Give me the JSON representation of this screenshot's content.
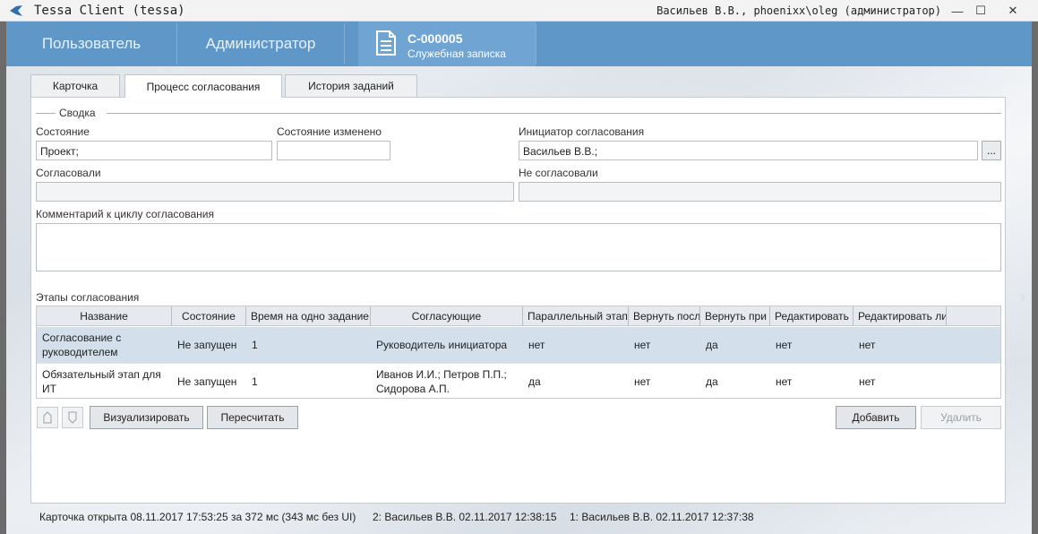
{
  "window": {
    "app_title": "Tessa Client (tessa)",
    "user_title": "Васильев В.В., phoenixx\\oleg (администратор)",
    "controls": {
      "minimize": "—",
      "maximize": "☐",
      "close": "✕"
    }
  },
  "header": {
    "tabs": [
      {
        "label": "Пользователь"
      },
      {
        "label": "Администратор"
      }
    ],
    "document": {
      "number": "C-000005",
      "type": "Служебная записка"
    }
  },
  "card_tabs": [
    {
      "label": "Карточка"
    },
    {
      "label": "Процесс согласования"
    },
    {
      "label": "История заданий"
    }
  ],
  "summary": {
    "group_label": "Сводка",
    "state_label": "Состояние",
    "state_value": "Проект;",
    "state_changed_label": "Состояние изменено",
    "state_changed_value": "",
    "initiator_label": "Инициатор согласования",
    "initiator_value": "Васильев В.В.;",
    "initiator_button": "...",
    "approved_label": "Согласовали",
    "approved_value": "",
    "not_approved_label": "Не согласовали",
    "not_approved_value": "",
    "comment_label": "Комментарий к циклу согласования",
    "comment_value": ""
  },
  "stages": {
    "label": "Этапы согласования",
    "columns": [
      "Название",
      "Состояние",
      "Время на одно задание",
      "Согласующие",
      "Параллельный этап",
      "Вернуть после",
      "Вернуть при",
      "Редактировать",
      "Редактировать лист"
    ],
    "rows": [
      {
        "name": "Согласование с руководителем",
        "state": "Не запущен",
        "time": "1",
        "approvers": "Руководитель инициатора",
        "parallel": "нет",
        "return_after": "нет",
        "return_on": "да",
        "edit": "нет",
        "edit_list": "нет"
      },
      {
        "name": "Обязательный этап для ИТ",
        "state": "Не запущен",
        "time": "1",
        "approvers": "Иванов И.И.; Петров П.П.; Сидорова А.П.",
        "parallel": "да",
        "return_after": "нет",
        "return_on": "да",
        "edit": "нет",
        "edit_list": "нет"
      }
    ]
  },
  "buttons": {
    "visualize": "Визуализировать",
    "recalculate": "Пересчитать",
    "add": "Добавить",
    "delete": "Удалить"
  },
  "status_bar": {
    "opened": "Карточка открыта 08.11.2017 17:53:25 за 372 мс (343 мс без UI)",
    "version2": "2:  Васильев В.В.  02.11.2017 12:38:15",
    "version1": "1:  Васильев В.В.  02.11.2017 12:37:38"
  },
  "colors": {
    "header": "#5f97c9",
    "header_active": "#6fa4d3",
    "selected_row": "#d3e0ec",
    "frame": "#6b6b6b"
  },
  "icons": [
    "tessa-logo-icon",
    "document-icon",
    "arrow-left-icon",
    "arrow-right-icon",
    "move-up-icon",
    "move-down-icon"
  ]
}
